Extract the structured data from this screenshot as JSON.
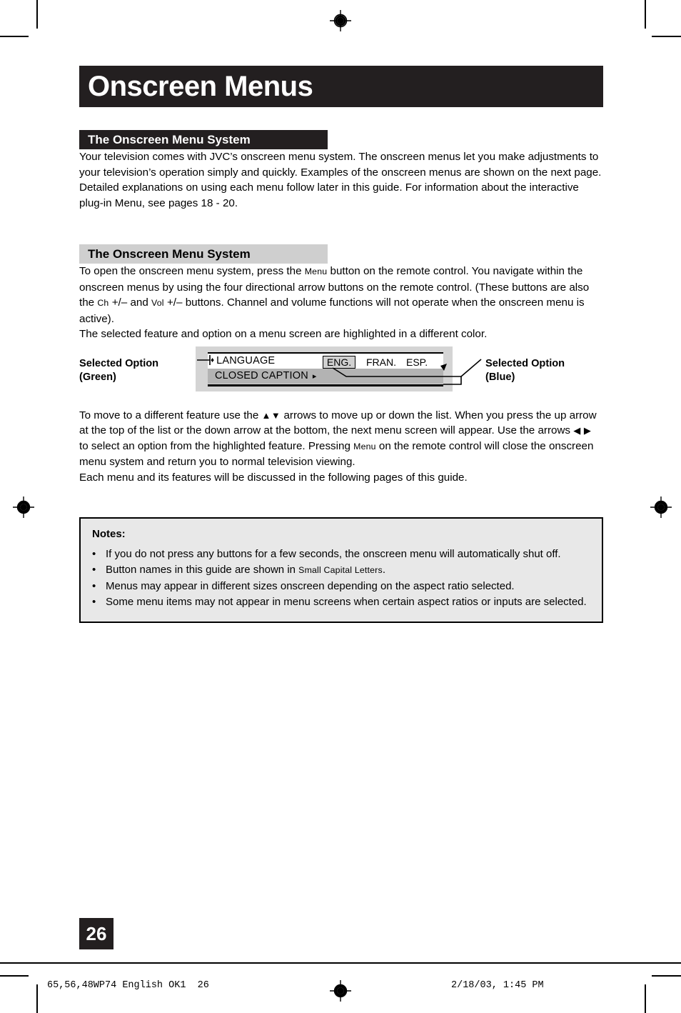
{
  "document": {
    "page_number": "26",
    "title": "Onscreen Menus"
  },
  "sections": {
    "heading_dark": "The Onscreen Menu System",
    "heading_gray": "The Onscreen Menu System",
    "intro_paragraph": "Your television comes with JVC’s onscreen menu system. The onscreen menus let you make adjustments to your television’s operation simply and quickly.  Examples of the onscreen menus are shown on the next page. Detailed explanations on using each menu follow later in this guide. For information about the interactive plug-in Menu, see pages 18 - 20.",
    "open_paragraph_1": "To open the onscreen menu system, press the ",
    "open_paragraph_menu_key": "Menu",
    "open_paragraph_2": " button on the remote control. You navigate within the onscreen menus by using the four directional arrow buttons on the remote control. (These buttons are also the ",
    "open_paragraph_ch_key": "Ch",
    "open_paragraph_3": " +/– and ",
    "open_paragraph_vol_key": "Vol",
    "open_paragraph_4": " +/– buttons. Channel and volume functions will not operate when the onscreen menu is active).",
    "selected_feature_paragraph": "The selected feature and option on a menu screen are highlighted in a different color.",
    "move_paragraph_1": "To move to a different feature use the ",
    "move_arrows_updown": "▲▼",
    "move_paragraph_2": " arrows to move up or down the list. When you press the up arrow at the top of the list or the down arrow at the bottom, the next menu screen will appear. Use the arrows ",
    "move_arrows_leftright": "◀ ▶",
    "move_paragraph_3": " to select an option from the highlighted feature. Pressing ",
    "move_menu_key": "Menu",
    "move_paragraph_4": " on the remote control will close the onscreen menu system and return you to normal television viewing.",
    "each_menu_paragraph": "Each menu and its features will be discussed in the following pages of this guide."
  },
  "figure": {
    "label_left_line1": "Selected Option",
    "label_left_line2": "(Green)",
    "label_right_line1": "Selected Option",
    "label_right_line2": "(Blue)",
    "menu_rows": [
      {
        "bullet": "♦",
        "name": "LANGUAGE",
        "caret": ""
      },
      {
        "bullet": "",
        "name": "CLOSED CAPTION",
        "caret": "▸"
      }
    ],
    "options": [
      {
        "label": "ENG.",
        "selected": true
      },
      {
        "label": "FRAN.",
        "selected": false
      },
      {
        "label": "ESP.",
        "selected": false
      }
    ]
  },
  "notes": {
    "title": "Notes:",
    "bullet_char": "•",
    "items": [
      {
        "text_before": "If you do not press any buttons for a few seconds, the onscreen menu will automatically shut off.",
        "smallcaps": "",
        "text_after": ""
      },
      {
        "text_before": "Button names in this guide are shown in ",
        "smallcaps": "Small Capital Letters",
        "text_after": "."
      },
      {
        "text_before": "Menus may appear in different sizes onscreen depending on the aspect ratio selected.",
        "smallcaps": "",
        "text_after": ""
      },
      {
        "text_before": "Some menu items may not appear in menu screens when certain aspect ratios or inputs are selected.",
        "smallcaps": "",
        "text_after": ""
      }
    ]
  },
  "footer": {
    "left": "65,56,48WP74 English OK1  26",
    "right": "2/18/03, 1:45 PM"
  },
  "colors": {
    "ink": "#231f20",
    "heading_gray": "#cfcfcf",
    "notes_bg": "#e8e8e8",
    "menu_backing": "#d4d4d4",
    "menu_row_highlight": "#b3b3b3",
    "option_box_fill": "#d0d0d0"
  }
}
